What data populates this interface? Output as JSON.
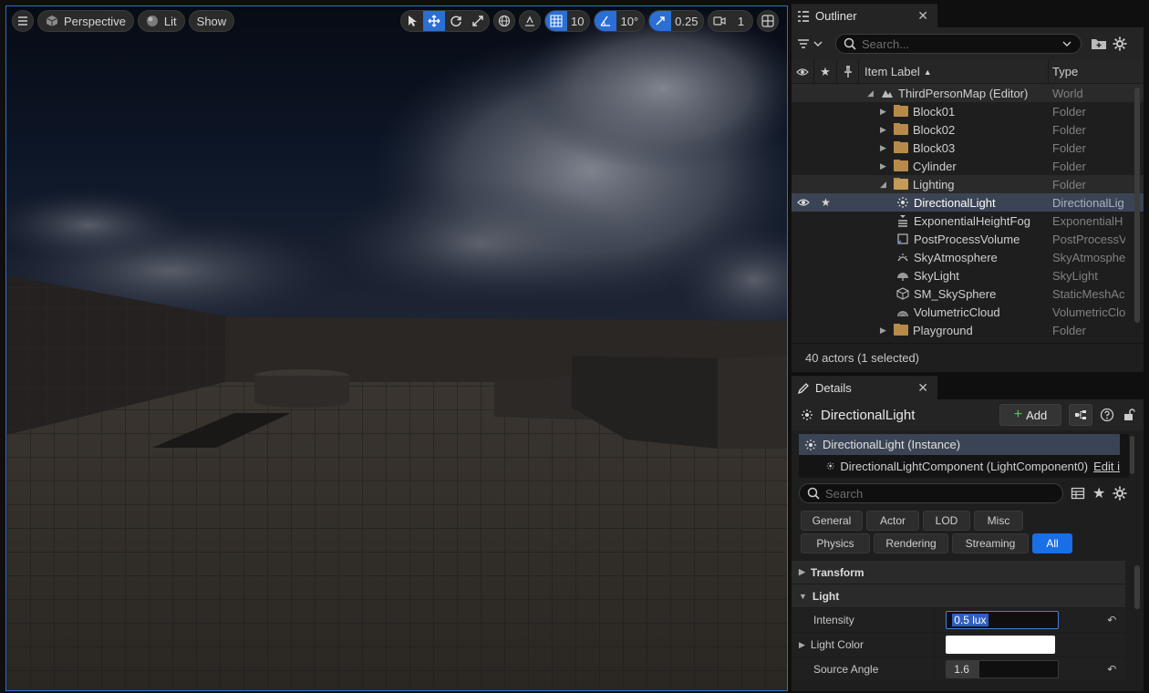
{
  "viewport": {
    "perspective_label": "Perspective",
    "lit_label": "Lit",
    "show_label": "Show",
    "grid_snap_value": "10",
    "rotation_snap_value": "10°",
    "scale_snap_value": "0.25",
    "camera_speed_value": "1"
  },
  "outliner": {
    "tab_title": "Outliner",
    "search_placeholder": "Search...",
    "col_item_label": "Item Label",
    "col_type": "Type",
    "rows": [
      {
        "label": "ThirdPersonMap (Editor)",
        "type": "World"
      },
      {
        "label": "Block01",
        "type": "Folder"
      },
      {
        "label": "Block02",
        "type": "Folder"
      },
      {
        "label": "Block03",
        "type": "Folder"
      },
      {
        "label": "Cylinder",
        "type": "Folder"
      },
      {
        "label": "Lighting",
        "type": "Folder"
      },
      {
        "label": "DirectionalLight",
        "type": "DirectionalLig"
      },
      {
        "label": "ExponentialHeightFog",
        "type": "ExponentialH"
      },
      {
        "label": "PostProcessVolume",
        "type": "PostProcessV"
      },
      {
        "label": "SkyAtmosphere",
        "type": "SkyAtmosphe"
      },
      {
        "label": "SkyLight",
        "type": "SkyLight"
      },
      {
        "label": "SM_SkySphere",
        "type": "StaticMeshAc"
      },
      {
        "label": "VolumetricCloud",
        "type": "VolumetricClo"
      },
      {
        "label": "Playground",
        "type": "Folder"
      }
    ],
    "status": "40 actors (1 selected)"
  },
  "details": {
    "tab_title": "Details",
    "actor_name": "DirectionalLight",
    "add_label": "Add",
    "instance_label": "DirectionalLight (Instance)",
    "component_label": "DirectionalLightComponent (LightComponent0)",
    "edit_label": "Edit i",
    "search_placeholder": "Search",
    "filters": [
      "General",
      "Actor",
      "LOD",
      "Misc",
      "Physics",
      "Rendering",
      "Streaming",
      "All"
    ],
    "sections": {
      "transform": "Transform",
      "light": "Light"
    },
    "props": {
      "intensity_label": "Intensity",
      "intensity_value": "0.5 lux",
      "light_color_label": "Light Color",
      "source_angle_label": "Source Angle",
      "source_angle_value": "1.6"
    }
  },
  "colors": {
    "accent": "#2b6fd6",
    "selection": "#3b4454",
    "folder": "#b88a4a"
  }
}
